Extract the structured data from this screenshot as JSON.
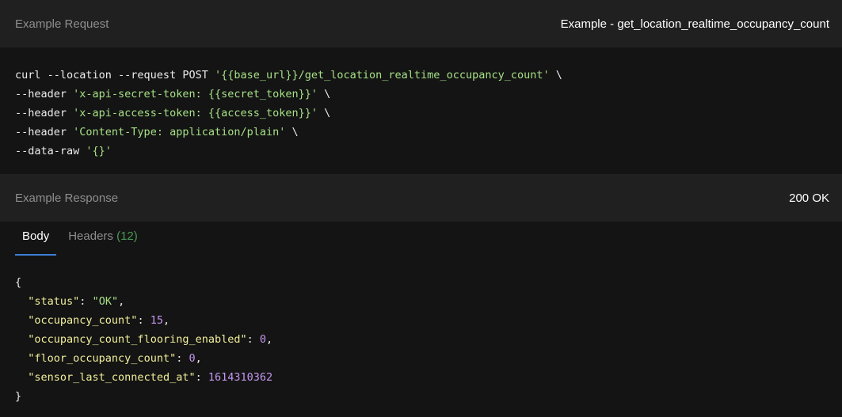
{
  "request": {
    "header_label": "Example Request",
    "example_name": "Example - get_location_realtime_occupancy_count",
    "code": {
      "line1_cmd": "curl --location --request POST ",
      "line1_url": "'{{base_url}}/get_location_realtime_occupancy_count'",
      "line1_tail": " \\",
      "line2_cmd": "--header ",
      "line2_val": "'x-api-secret-token: {{secret_token}}'",
      "line2_tail": " \\",
      "line3_cmd": "--header ",
      "line3_val": "'x-api-access-token: {{access_token}}'",
      "line3_tail": " \\",
      "line4_cmd": "--header ",
      "line4_val": "'Content-Type: application/plain'",
      "line4_tail": " \\",
      "line5_cmd": "--data-raw ",
      "line5_val": "'{}'"
    }
  },
  "response": {
    "header_label": "Example Response",
    "status": "200 OK",
    "tabs": {
      "body": "Body",
      "headers": "Headers",
      "headers_count": "(12)"
    },
    "json": {
      "open": "{",
      "close": "}",
      "k1": "\"status\"",
      "v1": "\"OK\"",
      "k2": "\"occupancy_count\"",
      "v2": "15",
      "k3": "\"occupancy_count_flooring_enabled\"",
      "v3": "0",
      "k4": "\"floor_occupancy_count\"",
      "v4": "0",
      "k5": "\"sensor_last_connected_at\"",
      "v5": "1614310362"
    }
  },
  "colors": {
    "string": "#a6e085",
    "number": "#c597f0",
    "key": "#f2f09a",
    "tab_active_underline": "#3d7fd6",
    "count": "#4a9a54"
  }
}
